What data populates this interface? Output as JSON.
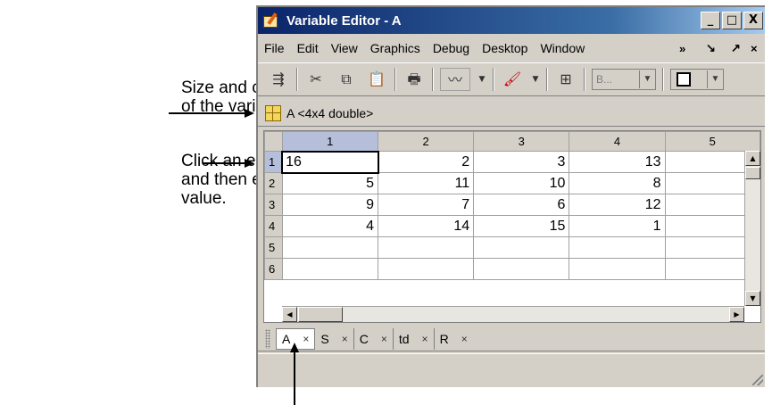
{
  "callouts": {
    "size_class": [
      "Size and class",
      "of the variable."
    ],
    "click_edit": [
      "Click an element",
      "and then edit its",
      "value."
    ]
  },
  "window": {
    "title": "Variable Editor - A",
    "buttons": {
      "minimize": "_",
      "maximize": "□",
      "close": "X"
    }
  },
  "menu": {
    "items": [
      "File",
      "Edit",
      "View",
      "Graphics",
      "Debug",
      "Desktop",
      "Window"
    ],
    "more": "»",
    "undock": "↘",
    "dock": "↗",
    "close": "×"
  },
  "toolbar": {
    "base_combo": "B...",
    "icons": [
      "import-data-icon",
      "cut-icon",
      "copy-icon",
      "paste-icon",
      "print-icon",
      "plot-selector-icon",
      "brush-icon",
      "link-icon",
      "base-workspace-icon",
      "tile-icon"
    ]
  },
  "variable": {
    "info": "A <4x4 double>"
  },
  "sheet": {
    "columns": [
      "1",
      "2",
      "3",
      "4",
      "5"
    ],
    "rows": [
      {
        "label": "1",
        "cells": [
          "16",
          "2",
          "3",
          "13",
          ""
        ]
      },
      {
        "label": "2",
        "cells": [
          "5",
          "11",
          "10",
          "8",
          ""
        ]
      },
      {
        "label": "3",
        "cells": [
          "9",
          "7",
          "6",
          "12",
          ""
        ]
      },
      {
        "label": "4",
        "cells": [
          "4",
          "14",
          "15",
          "1",
          ""
        ]
      },
      {
        "label": "5",
        "cells": [
          "",
          "",
          "",
          "",
          ""
        ]
      },
      {
        "label": "6",
        "cells": [
          "",
          "",
          "",
          "",
          ""
        ]
      }
    ]
  },
  "tabs": [
    {
      "label": "A",
      "close": "×"
    },
    {
      "label": "S",
      "close": "×"
    },
    {
      "label": "C",
      "close": "×"
    },
    {
      "label": "td",
      "close": "×"
    },
    {
      "label": "R",
      "close": "×"
    }
  ],
  "colors": {
    "title_bar": "#0a246a",
    "window_bg": "#d4d0c8",
    "selected_header": "#b5bfd9"
  }
}
